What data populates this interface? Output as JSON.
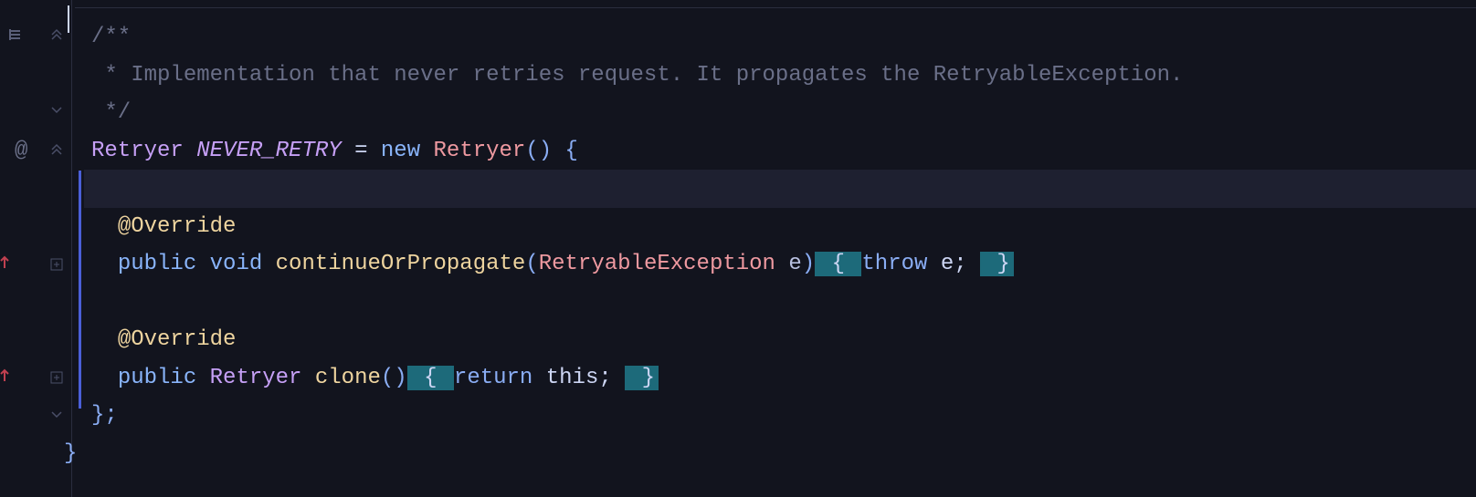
{
  "code": {
    "line1": "/**",
    "line2_prefix": " * ",
    "line2_text": "Implementation that never retries request. It propagates the RetryableException.",
    "line3": " */",
    "line4": {
      "type": "Retryer",
      "constant": "NEVER_RETRY",
      "eq": " = ",
      "new_kw": "new",
      "class": "Retryer",
      "paren": "()",
      "brace": " {"
    },
    "line6_annotation": "@Override",
    "line7": {
      "visibility": "public",
      "return_type": "void",
      "method": "continueOrPropagate",
      "open_paren": "(",
      "param_type": "RetryableException",
      "param_name": "e",
      "close_paren": ")",
      "body_open": " { ",
      "throw_kw": "throw",
      "throw_expr": " e; ",
      "body_close": " }"
    },
    "line9_annotation": "@Override",
    "line10": {
      "visibility": "public",
      "return_type": "Retryer",
      "method": "clone",
      "parens": "()",
      "body_open": " { ",
      "return_kw": "return",
      "return_expr": " this; ",
      "body_close": " }"
    },
    "line11": "};",
    "line12": "}"
  },
  "gutter": {
    "at_symbol": "@"
  }
}
